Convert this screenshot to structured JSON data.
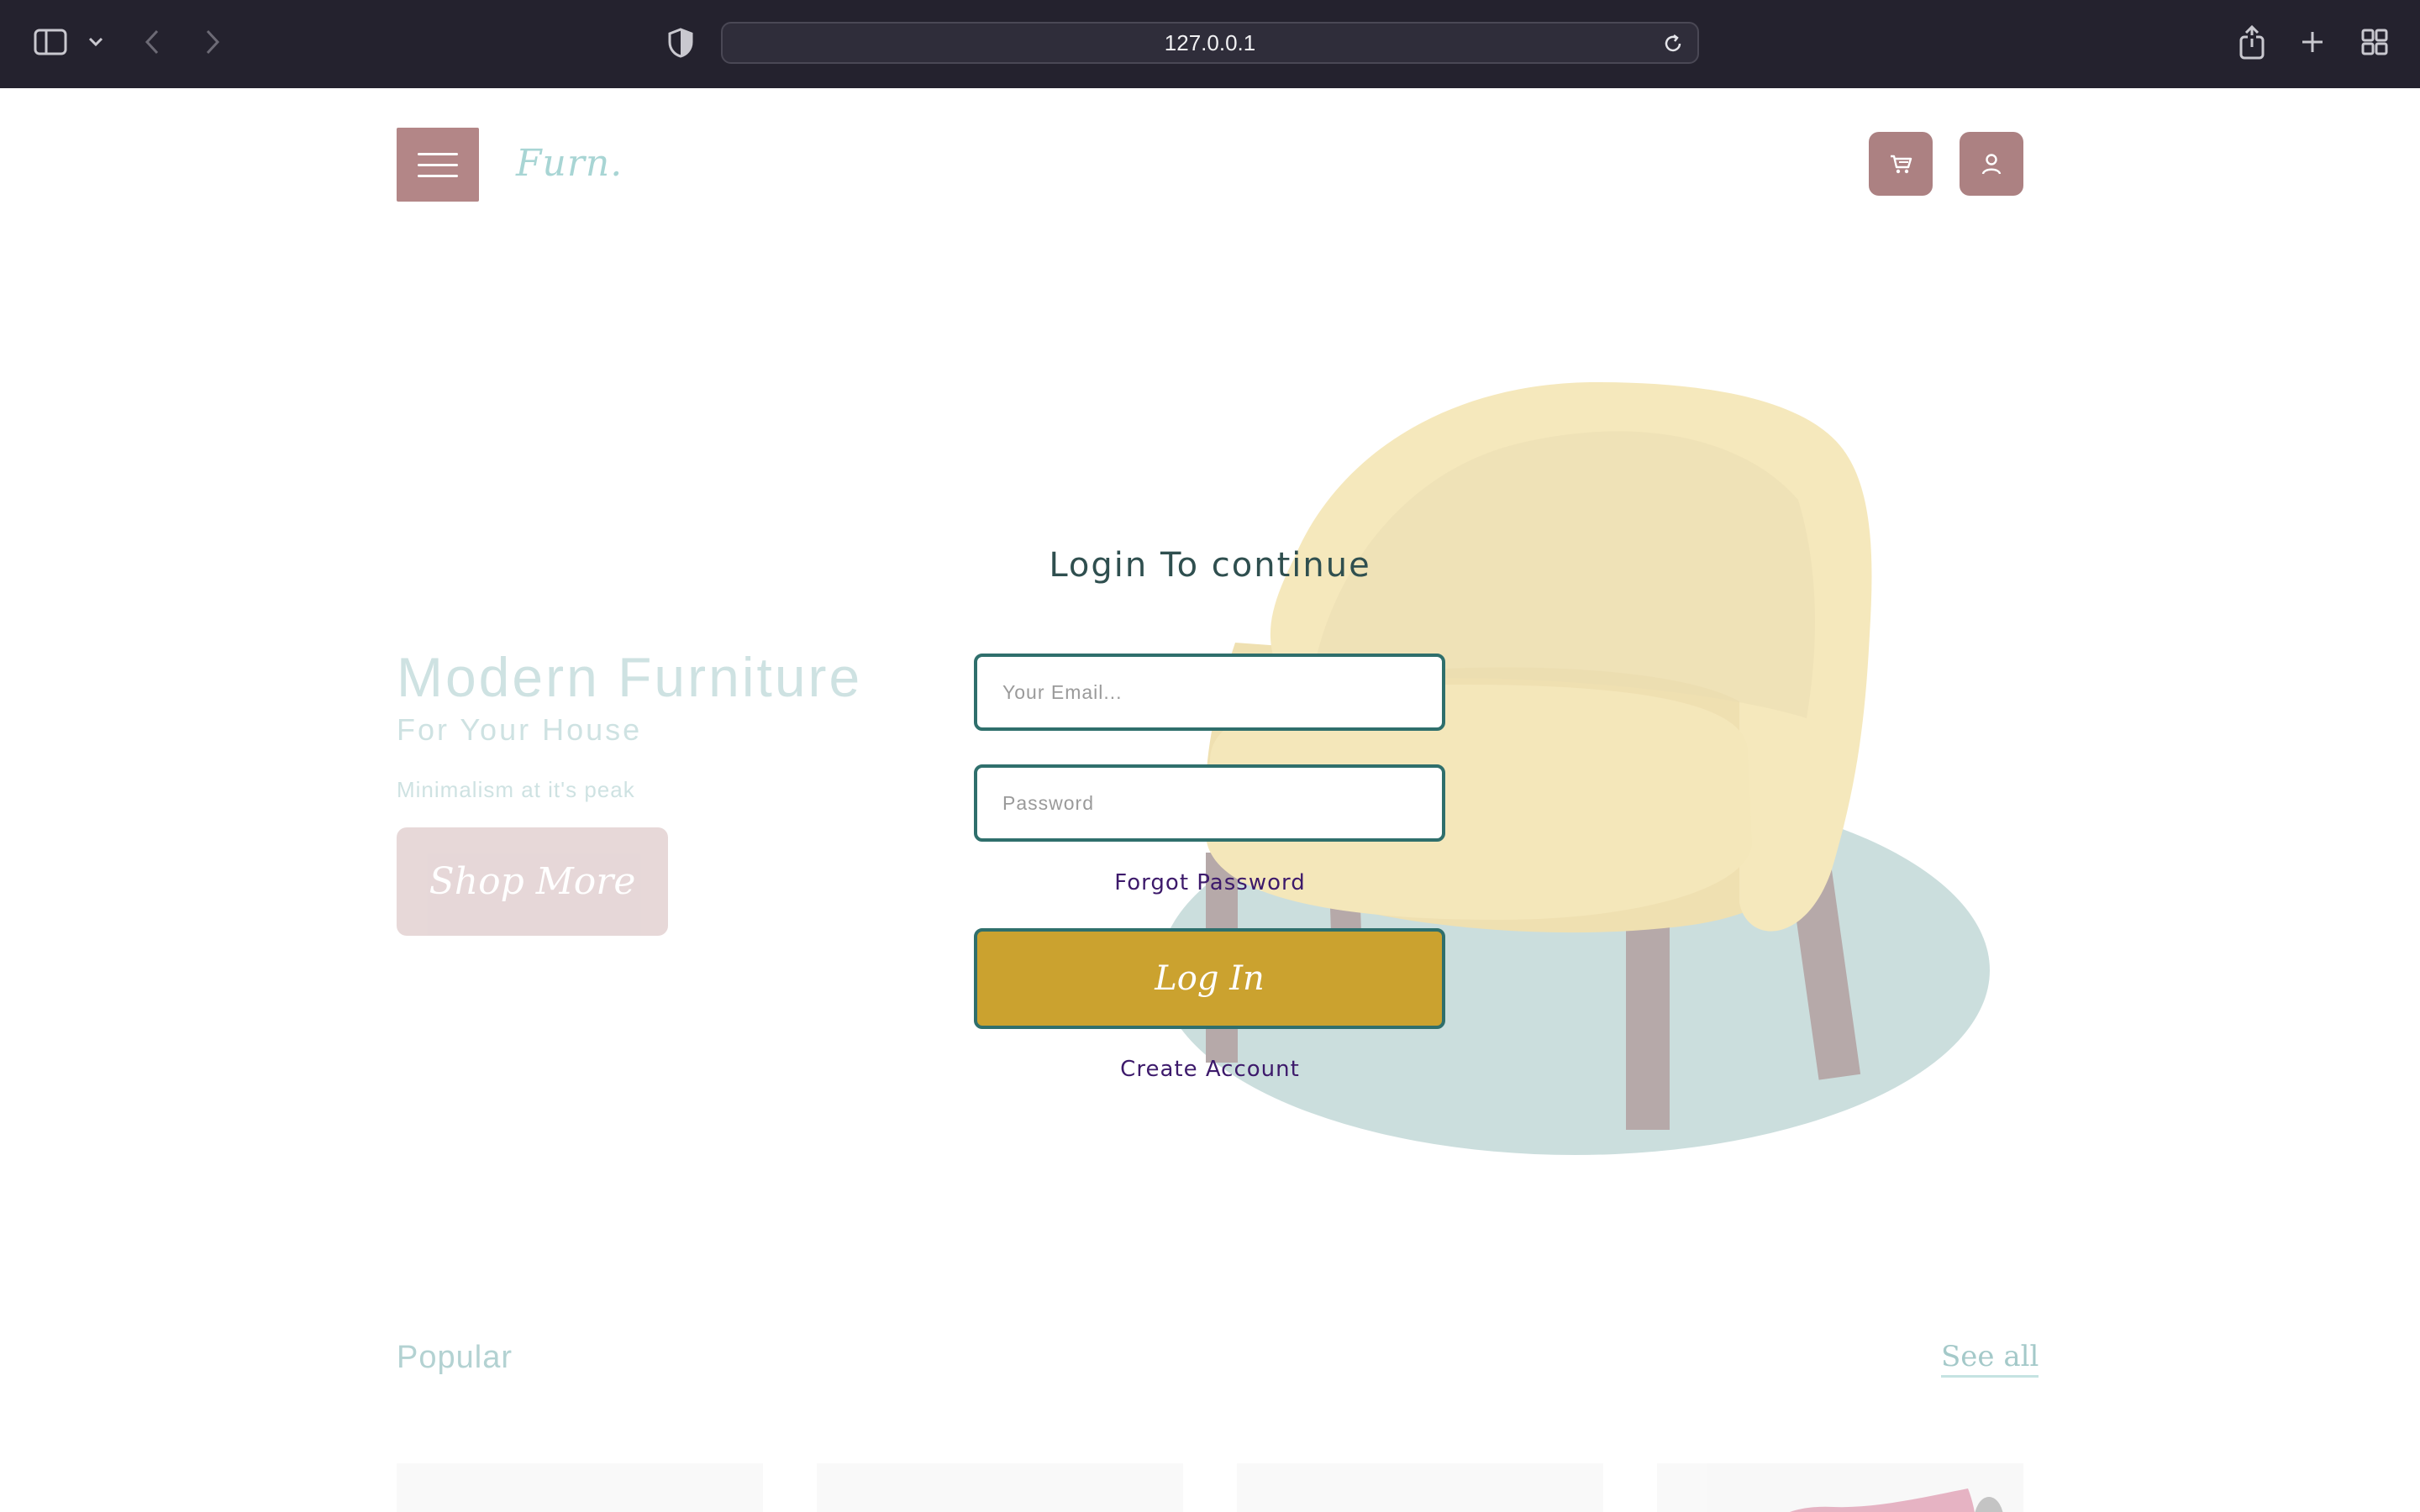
{
  "browser": {
    "url": "127.0.0.1"
  },
  "header": {
    "logo_text": "Furn."
  },
  "hero": {
    "title": "Modern Furniture",
    "subtitle": "For Your House",
    "tagline": "Minimalism at it's peak",
    "shop_button_label": "Shop More"
  },
  "login": {
    "title": "Login To continue",
    "email_placeholder": "Your Email...",
    "password_placeholder": "Password",
    "forgot_label": "Forgot Password",
    "login_button_label": "Log In",
    "create_account_label": "Create Account"
  },
  "popular": {
    "heading": "Popular",
    "see_all_label": "See all"
  },
  "colors": {
    "brand_mauve": "#b38687",
    "accent_teal": "#2f6f6c",
    "button_gold": "#cba22f",
    "link_purple": "#3d1a6b"
  }
}
